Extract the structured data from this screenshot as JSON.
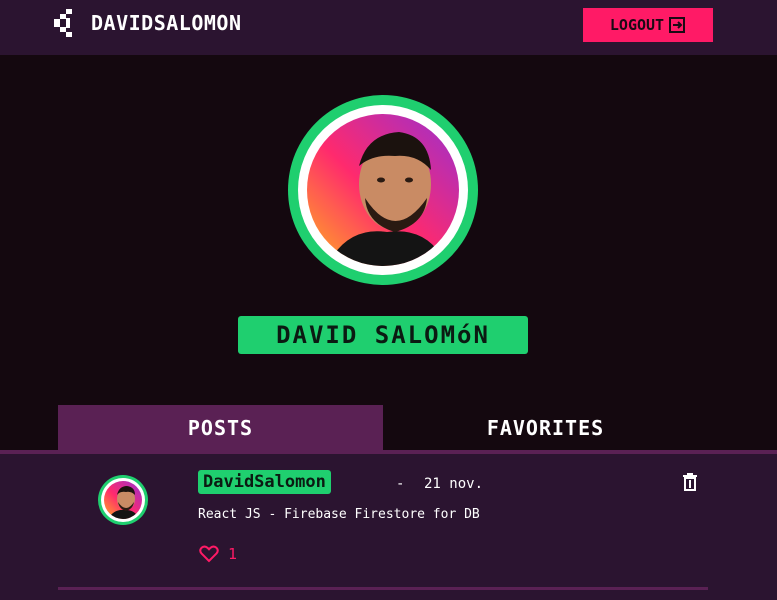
{
  "header": {
    "username": "DAVIDSALOMON",
    "logout_label": "LOGOUT",
    "back_icon": "chevron-left-icon",
    "logout_icon": "exit-icon"
  },
  "profile": {
    "display_name": "DAVID SALOMóN",
    "avatar": "profile-photo"
  },
  "tabs": [
    {
      "label": "POSTS",
      "active": true
    },
    {
      "label": "FAVORITES",
      "active": false
    }
  ],
  "posts": [
    {
      "author": "DavidSalomon",
      "separator": "-",
      "date": "21 nov.",
      "text": "React JS - Firebase Firestore for DB",
      "likes": "1",
      "delete_icon": "trash-icon",
      "like_icon": "heart-icon"
    }
  ],
  "colors": {
    "background": "#14080f",
    "bar": "#2b1430",
    "accent_green": "#1fcf6f",
    "accent_pink": "#ff1a66",
    "tab_active": "#5a2154"
  }
}
